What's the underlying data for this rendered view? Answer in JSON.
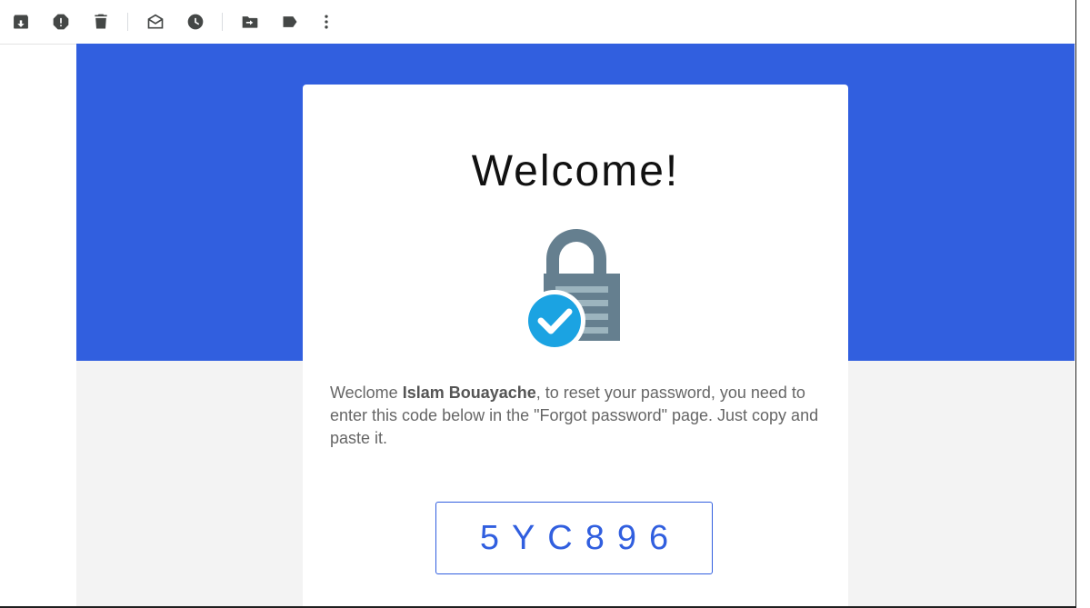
{
  "toolbar": {
    "icons": [
      "archive-icon",
      "report-spam-icon",
      "delete-icon",
      "mark-unread-icon",
      "snooze-icon",
      "move-to-icon",
      "label-icon",
      "more-icon"
    ]
  },
  "email": {
    "heading": "Welcome!",
    "greeting_prefix": "Weclome ",
    "user_name": "Islam Bouayache",
    "message_rest": ", to reset your password, you need to enter this code below in the \"Forgot password\" page. Just copy and paste it.",
    "code": "5YC896"
  },
  "colors": {
    "brand_blue": "#315fdf",
    "lock_gray": "#657f8f",
    "check_blue": "#1ba3e2"
  }
}
